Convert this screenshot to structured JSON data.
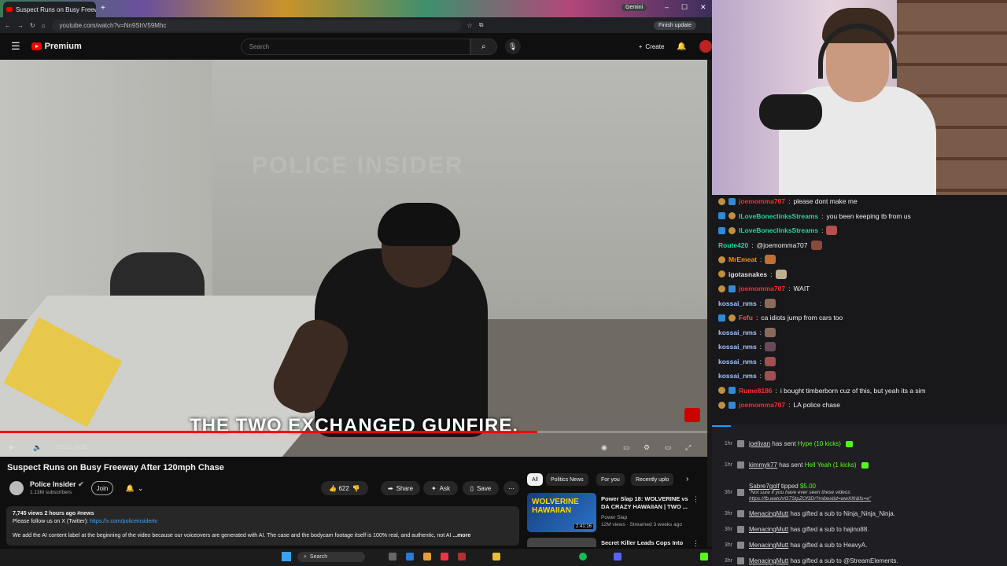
{
  "browser": {
    "tab_title": "Suspect Runs on Busy Freeway",
    "url": "youtube.com/watch?v=Nn9ShV59Mhc",
    "gemini_label": "Gemini",
    "finish_update": "Finish update"
  },
  "yt_header": {
    "logo_text": "Premium",
    "search_placeholder": "Search",
    "create_label": "Create"
  },
  "video": {
    "watermark": "POLICE INSIDER",
    "caption": "THE TWO EXCHANGED GUNFIRE.",
    "time": "11:02 / 14:32",
    "progress": 0.759
  },
  "meta": {
    "title": "Suspect Runs on Busy Freeway After 120mph Chase",
    "channel": "Police Insider",
    "subscribers": "1.13M subscribers",
    "join": "Join",
    "likes": "622",
    "share": "Share",
    "ask": "Ask",
    "save": "Save",
    "views_line": "7,745 views  2 hours ago  #news",
    "follow_text": "Please follow us on X (Twitter): ",
    "follow_link": "https://x.com/policeinsidertv",
    "desc_text": "We add the AI content label at the beginning of the video because our voiceovers are generated with AI. The case and the bodycam footage itself is 100% real, and authentic, not AI",
    "more": "...more"
  },
  "chips": [
    "All",
    "Politics News",
    "For you",
    "Recently uplo"
  ],
  "recommendations": [
    {
      "thumb_text": "WOLVERINE HAWAIIAN",
      "duration": "2:41:16",
      "title": "Power Slap 18: WOLVERINE vs DA CRAZY HAWAIIAN | TWO ...",
      "channel": "Power Slap",
      "stats": "12M views · Streamed 3 weeks ago"
    },
    {
      "title": "Secret Killer Leads Cops Into"
    }
  ],
  "taskbar": {
    "search": "Search"
  },
  "chat": [
    {
      "user": "joemomma707",
      "color": "#ff2a2a",
      "sep": ":",
      "msg": "please dont make me",
      "badges": [
        "y",
        "b"
      ]
    },
    {
      "user": "ILoveBoneclinksStreams",
      "color": "#20d6a0",
      "sep": ":",
      "msg": "you been keeping tb from us",
      "badges": [
        "b",
        "y"
      ]
    },
    {
      "user": "ILoveBoneclinksStreams",
      "color": "#20d6a0",
      "sep": ":",
      "msg": "",
      "badges": [
        "b",
        "y"
      ],
      "emote": "#b45050"
    },
    {
      "user": "Route420",
      "color": "#20d6a0",
      "sep": ":",
      "msg": "@joemomma707",
      "badges": [],
      "emote": "#8a4a3a"
    },
    {
      "user": "MrEmeat",
      "color": "#ff8c00",
      "sep": ":",
      "msg": "",
      "badges": [
        "y"
      ],
      "emote": "#c07030"
    },
    {
      "user": "igotasnakes",
      "color": "#e0e0e0",
      "sep": ":",
      "msg": "",
      "badges": [
        "y"
      ],
      "emote": "#c0b090"
    },
    {
      "user": "joemomma707",
      "color": "#ff2a2a",
      "sep": ":",
      "msg": "WAIT",
      "badges": [
        "y",
        "b"
      ]
    },
    {
      "user": "kossai_nms",
      "color": "#9fc3ff",
      "sep": ":",
      "msg": "",
      "badges": [],
      "emote": "#8a6a5a"
    },
    {
      "user": "Fefu",
      "color": "#ff4a4a",
      "sep": ":",
      "msg": "ca idiots jump from cars too",
      "badges": [
        "b",
        "y"
      ]
    },
    {
      "user": "kossai_nms",
      "color": "#9fc3ff",
      "sep": ":",
      "msg": "",
      "badges": [],
      "emote": "#8a6a5a"
    },
    {
      "user": "kossai_nms",
      "color": "#9fc3ff",
      "sep": ":",
      "msg": "",
      "badges": [],
      "emote": "#6a4a5a"
    },
    {
      "user": "kossai_nms",
      "color": "#9fc3ff",
      "sep": ":",
      "msg": "",
      "badges": [],
      "emote": "#a05050"
    },
    {
      "user": "kossai_nms",
      "color": "#9fc3ff",
      "sep": ":",
      "msg": "",
      "badges": [],
      "emote": "#a05050"
    },
    {
      "user": "Rume8186",
      "color": "#ff3030",
      "sep": ":",
      "msg": "i bought timberborn cuz of this, but yeah its a sim",
      "badges": [
        "y",
        "b"
      ]
    },
    {
      "user": "joemomma707",
      "color": "#ff2a2a",
      "sep": ":",
      "msg": "LA police chase",
      "badges": [
        "y",
        "b"
      ]
    }
  ],
  "events": [
    {
      "time": "1hr",
      "user": "joelivan",
      "text": " has sent ",
      "highlight": "Hype (10 kicks)",
      "kick": true
    },
    {
      "time": "1hr",
      "user": "kimmyk77",
      "text": " has sent ",
      "highlight": "Hell Yeah (1 kicks)",
      "kick": true
    },
    {
      "time": "3hr",
      "user": "Sabre7golf",
      "text": " tipped ",
      "highlight": "$5.00",
      "note": "\"Not sure if you have ever seen these videos",
      "link": "https://fb.watch/G7StpZOf3D/?mibextid=wwXIfr&fs=e\""
    },
    {
      "time": "3hr",
      "user": "MenacingMutt",
      "text": " has gifted a sub to ",
      "highlight": "Ninja_Ninja_Ninja."
    },
    {
      "time": "3hr",
      "user": "MenacingMutt",
      "text": " has gifted a sub to ",
      "highlight": "hajino88."
    },
    {
      "time": "3hr",
      "user": "MenacingMutt",
      "text": " has gifted a sub to ",
      "highlight": "HeavyA."
    },
    {
      "time": "3hr",
      "user": "MenacingMutt",
      "text": " has gifted a sub to ",
      "highlight": "@StreamElements."
    }
  ]
}
